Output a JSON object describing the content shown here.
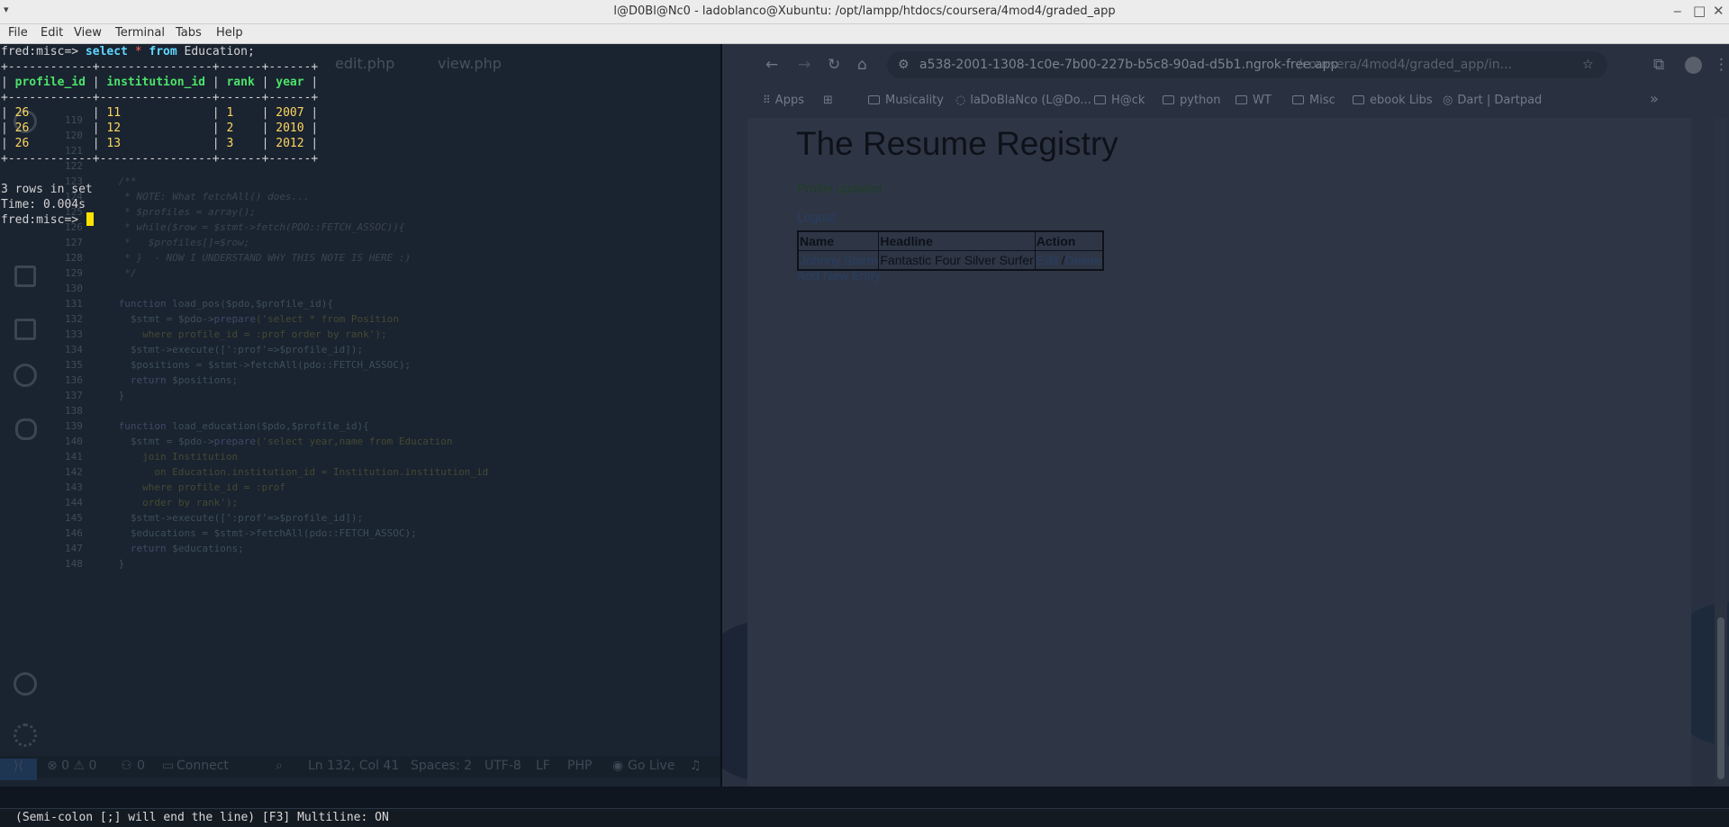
{
  "window": {
    "title": "l@D0Bl@Nc0 - ladoblanco@Xubuntu: /opt/lampp/htdocs/coursera/4mod4/graded_app",
    "menu_glyph": "▾",
    "minimize": "‒",
    "maximize": "□",
    "close": "✕"
  },
  "menubar": {
    "items": [
      "File",
      "Edit",
      "View",
      "Terminal",
      "Tabs",
      "Help"
    ]
  },
  "terminal": {
    "prompt": "fred:misc=>",
    "cmd_select": "select",
    "cmd_star": "*",
    "cmd_from": "from",
    "cmd_table": "Education;",
    "border": "+------------+----------------+------+------+",
    "headers": [
      "profile_id",
      "institution_id",
      "rank",
      "year"
    ],
    "rows": [
      [
        "26",
        "11",
        "1",
        "2007"
      ],
      [
        "26",
        "12",
        "2",
        "2010"
      ],
      [
        "26",
        "13",
        "3",
        "2012"
      ]
    ],
    "rows_info": "3 rows in set",
    "time_info": "Time: 0.004s",
    "bottom_hint": "(Semi-colon [;] will end the line) [F3] Multiline: ON"
  },
  "editor_ghost": {
    "tabs": [
      "edit.php",
      "view.php"
    ],
    "status": {
      "problems": "⊗ 0 ⚠ 0",
      "ports": "0",
      "connect": "Connect",
      "position": "Ln 132, Col 41",
      "spaces": "Spaces: 2",
      "encoding": "UTF-8",
      "eol": "LF",
      "language": "PHP",
      "golive": "Go Live"
    }
  },
  "browser": {
    "url_host": "a538-2001-1308-1c0e-7b00-227b-b5c8-90ad-d5b1.ngrok-free.app",
    "url_path": "/coursera/4mod4/graded_app/in...",
    "bookmarks": [
      "Apps",
      "Musicality",
      "laDoBlaNco (L@Do...",
      "H@ck",
      "python",
      "WT",
      "Misc",
      "ebook Libs",
      "Dart | Dartpad"
    ],
    "more": "»"
  },
  "page": {
    "title": "The Resume Registry",
    "flash": "Profile updated",
    "logout": "Logout",
    "table_headers": [
      "Name",
      "Headline",
      "Action"
    ],
    "entries": [
      {
        "name": "Johnny Storm",
        "headline": "Fantastic Four Silver Surfer",
        "edit": "Edit",
        "sep": "/",
        "delete": "Delete"
      }
    ],
    "add_new": "Add New Entry"
  },
  "colors": {
    "terminal_bg": "#1a2330",
    "keyword": "#5fd7ff",
    "header_green": "#4ce36a",
    "value_yellow": "#ffd75f",
    "page_bg_dimmed": "#2e3646"
  }
}
